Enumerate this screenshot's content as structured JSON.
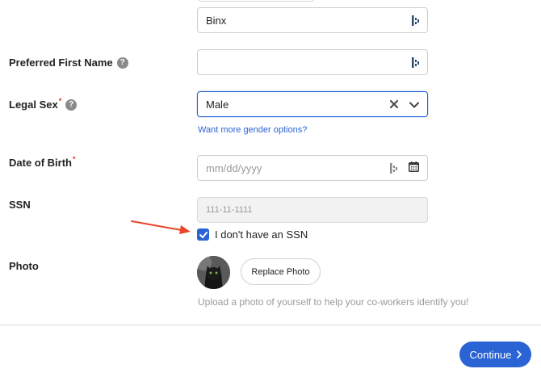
{
  "name_field": {
    "value": "Binx"
  },
  "preferred_first_name": {
    "label": "Preferred First Name",
    "value": ""
  },
  "legal_sex": {
    "label": "Legal Sex",
    "value": "Male"
  },
  "gender_link": "Want more gender options?",
  "date_of_birth": {
    "label": "Date of Birth",
    "placeholder": "mm/dd/yyyy"
  },
  "ssn": {
    "label": "SSN",
    "placeholder": "111-11-1111"
  },
  "no_ssn_checkbox": {
    "label": "I don't have an SSN",
    "checked": true
  },
  "photo": {
    "label": "Photo",
    "replace_button": "Replace Photo",
    "hint": "Upload a photo of yourself to help your co-workers identify you!"
  },
  "footer": {
    "continue_button": "Continue"
  },
  "colors": {
    "accent": "#2a63d4",
    "annotation_arrow": "#e8462a",
    "required": "#d8352a"
  },
  "icons": [
    "password-manager-icon",
    "help-icon",
    "clear-icon",
    "chevron-down-icon",
    "calendar-icon",
    "check-icon",
    "chevron-right-icon"
  ]
}
